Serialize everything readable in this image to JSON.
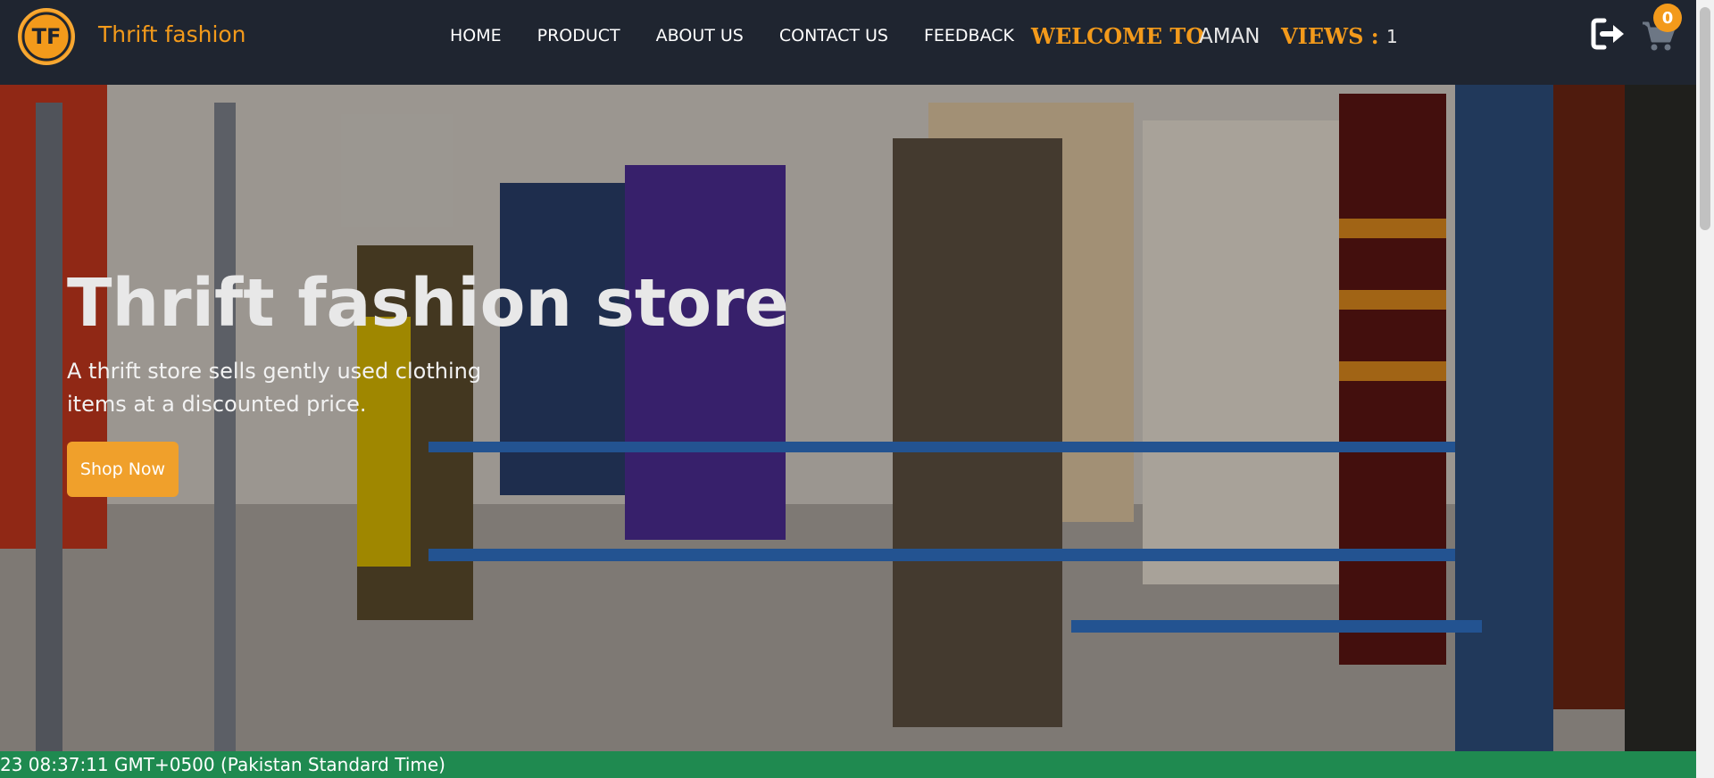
{
  "navbar": {
    "brand": "Thrift fashion",
    "logo_text": "TF",
    "links": [
      "HOME",
      "PRODUCT",
      "ABOUT US",
      "CONTACT US",
      "FEEDBACK"
    ],
    "welcome_label": "WELCOME TO",
    "username": "AMAN",
    "views_label": "VIEWS :",
    "views_count": "1",
    "cart_count": "0"
  },
  "hero": {
    "title": "Thrift fashion store",
    "description": "A thrift store sells gently used clothing items at a discounted price.",
    "button_label": "Shop Now"
  },
  "status_bar": {
    "text": "23 08:37:11 GMT+0500 (Pakistan Standard Time)"
  },
  "icons": {
    "logout": "logout-icon",
    "cart": "cart-icon"
  },
  "colors": {
    "accent": "#f39a1b",
    "navbar_bg": "#1f2530",
    "status_bg": "#1f8a50"
  }
}
